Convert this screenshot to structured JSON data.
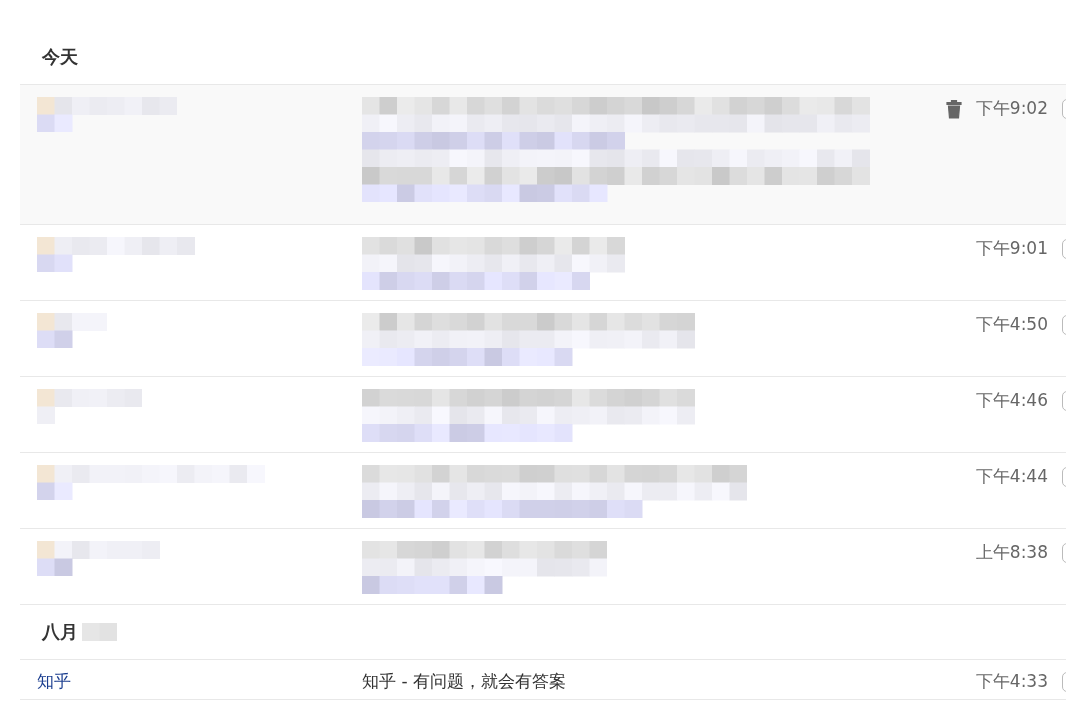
{
  "sections": [
    {
      "title": "今天",
      "blurred_suffix": false,
      "rows": [
        {
          "kind": "pixelated",
          "time": "下午9:02",
          "hovered": true,
          "checked": false
        },
        {
          "kind": "pixelated",
          "time": "下午9:01",
          "hovered": false,
          "checked": false
        },
        {
          "kind": "pixelated",
          "time": "下午4:50",
          "hovered": false,
          "checked": false
        },
        {
          "kind": "pixelated",
          "time": "下午4:46",
          "hovered": false,
          "checked": false
        },
        {
          "kind": "pixelated",
          "time": "下午4:44",
          "hovered": false,
          "checked": false
        },
        {
          "kind": "pixelated",
          "time": "上午8:38",
          "hovered": false,
          "checked": false
        }
      ]
    },
    {
      "title": "八月",
      "blurred_suffix": true,
      "rows": [
        {
          "kind": "text",
          "sender": "知乎",
          "subject": "知乎 - 有问题，就会有答案",
          "time": "下午4:33",
          "hovered": false,
          "checked": false
        }
      ]
    }
  ]
}
